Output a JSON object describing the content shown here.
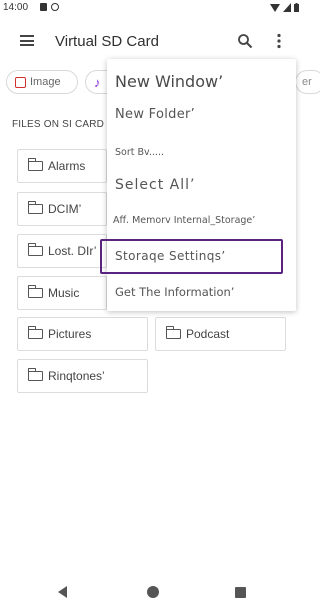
{
  "status_bar": {
    "time": "14:00",
    "left_icons": [
      "notification-icon",
      "sync-icon"
    ],
    "right_icons": [
      "wifi-icon",
      "signal-icon",
      "battery-icon"
    ]
  },
  "app_bar": {
    "title": "Virtual SD Card",
    "menu_icon": "hamburger-icon",
    "search_icon": "search-icon",
    "more_icon": "more-vert-icon"
  },
  "chips": [
    {
      "label": "Image",
      "icon": "image-icon",
      "accent": "#d03030"
    },
    {
      "label": "",
      "icon": "music-note-icon",
      "accent": "#8a2be2"
    },
    {
      "label": "er",
      "icon": ""
    }
  ],
  "section_label": "FILES ON SI CARD",
  "folders": [
    {
      "label": "Alarms"
    },
    {
      "label": "DCIM’"
    },
    {
      "label": "Lost. DIr’"
    },
    {
      "label": "Music"
    },
    {
      "label": "Pictures"
    },
    {
      "label": "Podcast"
    },
    {
      "label": "Rinqtones’"
    }
  ],
  "overflow_menu": {
    "items": [
      {
        "label": "New Window’"
      },
      {
        "label": "New Folder’"
      },
      {
        "label": "Sort Bv....."
      },
      {
        "label": "Select All’"
      },
      {
        "label": "Aff. Memorv Internal_Storage’"
      },
      {
        "label": "Storaqe Settinqs’"
      },
      {
        "label": "Get The Information’"
      }
    ],
    "highlighted_item": "Storaqe Settinqs’",
    "highlight_color": "#5b2380"
  },
  "nav_bar": {
    "icons": [
      "back-icon",
      "home-icon",
      "recents-icon"
    ]
  }
}
